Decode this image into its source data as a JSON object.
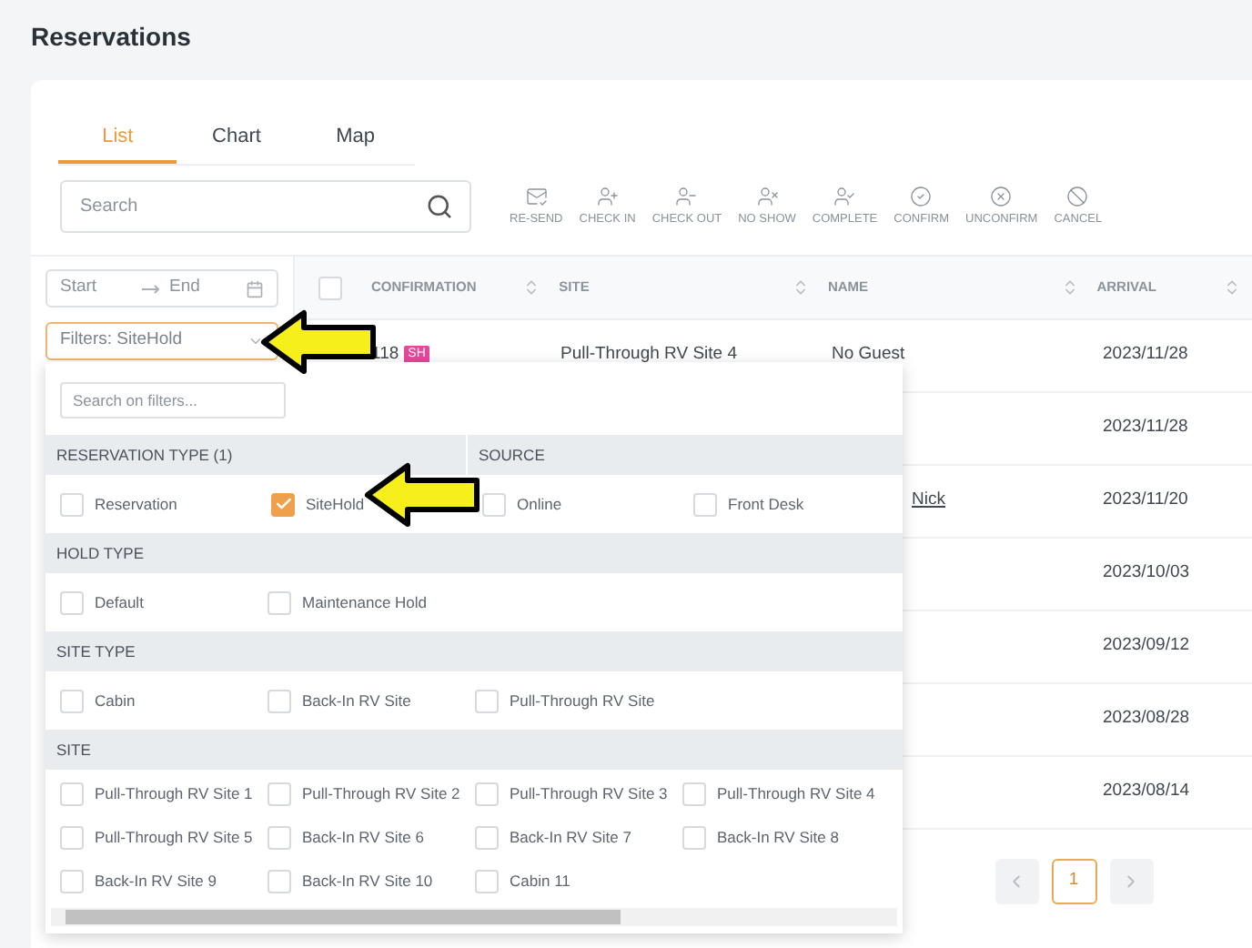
{
  "page_title": "Reservations",
  "tabs": [
    {
      "label": "List",
      "selected": true
    },
    {
      "label": "Chart",
      "selected": false
    },
    {
      "label": "Map",
      "selected": false
    }
  ],
  "search": {
    "placeholder": "Search"
  },
  "actions": [
    {
      "kind": "mail",
      "label": "RE-SEND"
    },
    {
      "kind": "checkin",
      "label": "CHECK IN"
    },
    {
      "kind": "checkout",
      "label": "CHECK OUT"
    },
    {
      "kind": "noshow",
      "label": "NO SHOW"
    },
    {
      "kind": "complete",
      "label": "COMPLETE"
    },
    {
      "kind": "confirm",
      "label": "CONFIRM"
    },
    {
      "kind": "unconfirm",
      "label": "UNCONFIRM"
    },
    {
      "kind": "cancel",
      "label": "CANCEL"
    }
  ],
  "date_range": {
    "start_placeholder": "Start",
    "end_placeholder": "End"
  },
  "filters_select": {
    "value": "Filters: SiteHold"
  },
  "table": {
    "select_all_checked": false,
    "columns": [
      "CONFIRMATION",
      "SITE",
      "NAME",
      "ARRIVAL"
    ],
    "rows": [
      {
        "confirmation": "118",
        "badge": "SH",
        "site": "Pull-Through RV Site 4",
        "name": "No Guest",
        "name_link": false,
        "covered": false,
        "arrival": "2023/11/28"
      },
      {
        "arrival": "2023/11/28"
      },
      {
        "name": "Nick",
        "name_link": true,
        "covered": true,
        "arrival": "2023/11/20"
      },
      {
        "arrival": "2023/10/03"
      },
      {
        "arrival": "2023/09/12"
      },
      {
        "arrival": "2023/08/28"
      },
      {
        "arrival": "2023/08/14"
      }
    ]
  },
  "pagination": {
    "pages": [
      {
        "label": "1",
        "selected": true
      }
    ]
  },
  "filter_panel": {
    "search_placeholder": "Search on filters...",
    "sections": [
      {
        "groups": [
          {
            "title": "RESERVATION TYPE (1)",
            "options": [
              {
                "label": "Reservation",
                "checked": false
              },
              {
                "label": "SiteHold",
                "checked": true
              }
            ]
          },
          {
            "title": "SOURCE",
            "options": [
              {
                "label": "Online",
                "checked": false
              },
              {
                "label": "Front Desk",
                "checked": false
              }
            ]
          }
        ]
      },
      {
        "groups": [
          {
            "title": "HOLD TYPE",
            "options": [
              {
                "label": "Default",
                "checked": false
              },
              {
                "label": "Maintenance Hold",
                "checked": false
              }
            ]
          }
        ]
      },
      {
        "groups": [
          {
            "title": "SITE TYPE",
            "options": [
              {
                "label": "Cabin",
                "checked": false
              },
              {
                "label": "Back-In RV Site",
                "checked": false
              },
              {
                "label": "Pull-Through RV Site",
                "checked": false
              }
            ]
          }
        ]
      },
      {
        "groups": [
          {
            "title": "SITE",
            "options": [
              {
                "label": "Pull-Through RV Site 1",
                "checked": false
              },
              {
                "label": "Pull-Through RV Site 2",
                "checked": false
              },
              {
                "label": "Pull-Through RV Site 3",
                "checked": false
              },
              {
                "label": "Pull-Through RV Site 4",
                "checked": false
              },
              {
                "label": "Pull-Through RV Site 5",
                "checked": false
              },
              {
                "label": "Back-In RV Site 6",
                "checked": false
              },
              {
                "label": "Back-In RV Site 7",
                "checked": false
              },
              {
                "label": "Back-In RV Site 8",
                "checked": false
              },
              {
                "label": "Back-In RV Site 9",
                "checked": false
              },
              {
                "label": "Back-In RV Site 10",
                "checked": false
              },
              {
                "label": "Cabin 11",
                "checked": false
              }
            ]
          }
        ]
      }
    ]
  }
}
